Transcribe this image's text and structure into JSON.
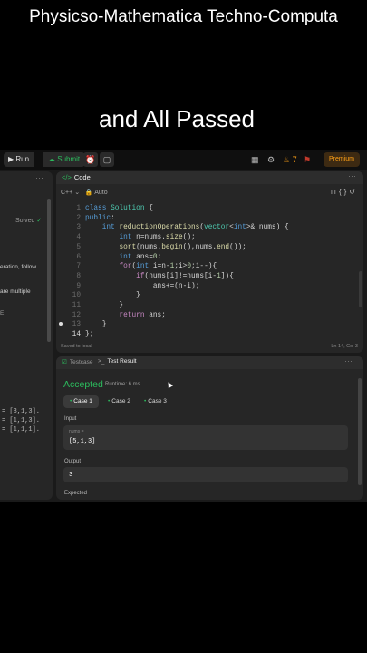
{
  "overlay": {
    "top_caption": "Physicso-Mathematica Techno-Computa",
    "mid_caption": "and All Passed"
  },
  "toolbar": {
    "run_label": "Run",
    "submit_label": "Submit",
    "streak": "7",
    "premium_label": "Premium"
  },
  "left_panel": {
    "solved_label": "Solved",
    "text_1": "eration, follow",
    "text_2": "are multiple",
    "text_3": "E",
    "example_1": "= [3,1,3].",
    "example_2": "= [1,1,3].",
    "example_3": "= [1,1,1]."
  },
  "code_panel": {
    "title": "Code",
    "language": "C++",
    "mode": "Auto",
    "line_numbers": [
      "1",
      "2",
      "3",
      "4",
      "5",
      "6",
      "7",
      "8",
      "9",
      "10",
      "11",
      "12",
      "13",
      "14"
    ],
    "saved_status": "Saved to local",
    "cursor_position": "Ln 14, Col 3"
  },
  "result_panel": {
    "testcase_tab": "Testcase",
    "result_tab": "Test Result",
    "status": "Accepted",
    "runtime": "Runtime: 6 ms",
    "cases": [
      "Case 1",
      "Case 2",
      "Case 3"
    ],
    "input_label": "Input",
    "input_name": "nums =",
    "input_value": "[5,1,3]",
    "output_label": "Output",
    "output_value": "3",
    "expected_label": "Expected"
  },
  "colors": {
    "accent_green": "#2cbb5d",
    "premium_orange": "#ffa116",
    "panel_bg": "#262626"
  }
}
